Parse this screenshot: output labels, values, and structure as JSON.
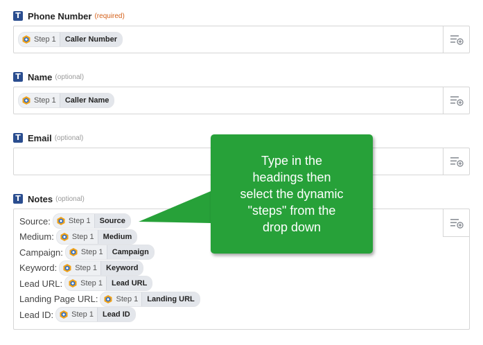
{
  "fields": [
    {
      "label": "Phone Number",
      "tag": "(required)",
      "pill": {
        "step": "Step 1",
        "value": "Caller Number"
      }
    },
    {
      "label": "Name",
      "tag": "(optional)",
      "pill": {
        "step": "Step 1",
        "value": "Caller Name"
      }
    },
    {
      "label": "Email",
      "tag": "(optional)",
      "value": ""
    },
    {
      "label": "Notes",
      "tag": "(optional)"
    }
  ],
  "notes_lines": [
    {
      "prefix": "Source:",
      "step": "Step 1",
      "value": "Source"
    },
    {
      "prefix": "Medium:",
      "step": "Step 1",
      "value": "Medium"
    },
    {
      "prefix": "Campaign:",
      "step": "Step 1",
      "value": "Campaign"
    },
    {
      "prefix": "Keyword:",
      "step": "Step 1",
      "value": "Keyword"
    },
    {
      "prefix": "Lead URL:",
      "step": "Step 1",
      "value": "Lead URL"
    },
    {
      "prefix": "Landing Page URL:",
      "step": "Step 1",
      "value": "Landing URL"
    },
    {
      "prefix": "Lead ID:",
      "step": "Step 1",
      "value": "Lead ID"
    }
  ],
  "callout": {
    "text": "Type in the headings then select the dynamic \"steps\" from the drop down",
    "lines": [
      "Type in the",
      "headings then",
      "select the dynamic",
      "\"steps\" from the",
      "drop down"
    ]
  },
  "icons": {
    "field_type": "text-type-icon",
    "step_logo": "step-app-logo-icon",
    "insert": "insert-data-icon"
  },
  "colors": {
    "callout_bg": "#27a139",
    "required": "#d4601a",
    "field_icon": "#2a4d8f"
  }
}
